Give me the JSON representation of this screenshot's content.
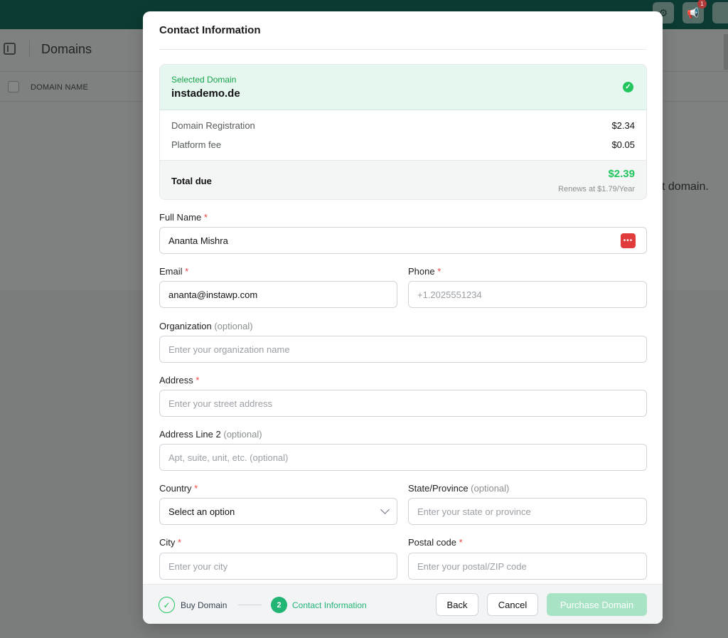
{
  "background": {
    "page_title": "Domains",
    "table_column": "DOMAIN NAME",
    "empty_text_fragment": "t domain.",
    "notification_count": "1"
  },
  "modal": {
    "title": "Contact Information",
    "summary": {
      "selected_label": "Selected Domain",
      "selected_domain": "instademo.de",
      "lines": [
        {
          "label": "Domain Registration",
          "amount": "$2.34"
        },
        {
          "label": "Platform fee",
          "amount": "$0.05"
        }
      ],
      "total_label": "Total due",
      "total_amount": "$2.39",
      "renews_text": "Renews at $1.79/Year"
    },
    "form": {
      "full_name": {
        "label": "Full Name",
        "value": "Ananta Mishra"
      },
      "email": {
        "label": "Email",
        "value": "ananta@instawp.com"
      },
      "phone": {
        "label": "Phone",
        "placeholder": "+1.2025551234"
      },
      "organization": {
        "label": "Organization",
        "optional": "(optional)",
        "placeholder": "Enter your organization name"
      },
      "address": {
        "label": "Address",
        "placeholder": "Enter your street address"
      },
      "address2": {
        "label": "Address Line 2",
        "optional": "(optional)",
        "placeholder": "Apt, suite, unit, etc. (optional)"
      },
      "country": {
        "label": "Country",
        "value": "Select an option"
      },
      "state": {
        "label": "State/Province",
        "optional": "(optional)",
        "placeholder": "Enter your state or province"
      },
      "city": {
        "label": "City",
        "placeholder": "Enter your city"
      },
      "postal": {
        "label": "Postal code",
        "placeholder": "Enter your postal/ZIP code"
      },
      "required_mark": "*"
    },
    "footer": {
      "step1_label": "Buy Domain",
      "step2_number": "2",
      "step2_label": "Contact Information",
      "back_label": "Back",
      "cancel_label": "Cancel",
      "purchase_label": "Purchase Domain"
    }
  },
  "colors": {
    "accent": "#22b573",
    "required": "#ef4444",
    "topbar": "#0b3b32"
  }
}
